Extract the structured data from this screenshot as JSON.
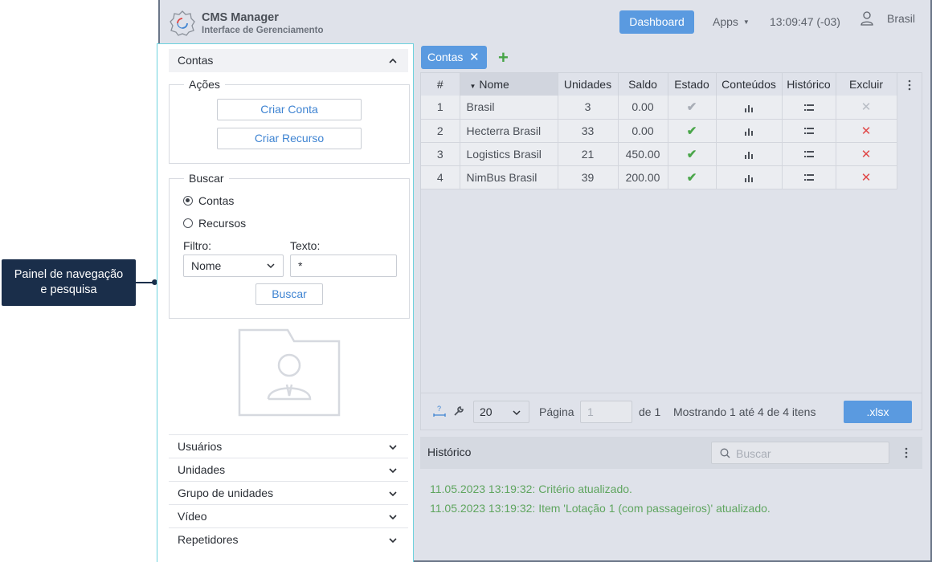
{
  "annotation": {
    "label_line1": "Painel de navegação",
    "label_line2": "e pesquisa"
  },
  "header": {
    "title": "CMS Manager",
    "subtitle": "Interface de Gerenciamento",
    "dashboard_label": "Dashboard",
    "apps_label": "Apps",
    "clock": "13:09:47 (-03)",
    "user": "Brasil"
  },
  "left": {
    "section_title": "Contas",
    "actions": {
      "legend": "Ações",
      "create_account": "Criar Conta",
      "create_resource": "Criar Recurso"
    },
    "search": {
      "legend": "Buscar",
      "radio_accounts": "Contas",
      "radio_resources": "Recursos",
      "filter_label": "Filtro:",
      "filter_value": "Nome",
      "text_label": "Texto:",
      "text_value": "*",
      "button": "Buscar"
    },
    "accordion": [
      "Usuários",
      "Unidades",
      "Grupo de unidades",
      "Vídeo",
      "Repetidores"
    ]
  },
  "tab": {
    "label": "Contas"
  },
  "table": {
    "headers": [
      "#",
      "Nome",
      "Unidades",
      "Saldo",
      "Estado",
      "Conteúdos",
      "Histórico",
      "Excluir"
    ],
    "rows": [
      {
        "n": "1",
        "name": "Brasil",
        "units": "3",
        "balance": "0.00",
        "active": false
      },
      {
        "n": "2",
        "name": "Hecterra Brasil",
        "units": "33",
        "balance": "0.00",
        "active": true
      },
      {
        "n": "3",
        "name": "Logistics Brasil",
        "units": "21",
        "balance": "450.00",
        "active": true
      },
      {
        "n": "4",
        "name": "NimBus Brasil",
        "units": "39",
        "balance": "200.00",
        "active": true
      }
    ]
  },
  "pager": {
    "page_size": "20",
    "page_label": "Página",
    "page_value": "1",
    "of_label": "de 1",
    "showing": "Mostrando 1 até 4 de 4 itens",
    "export": ".xlsx"
  },
  "history": {
    "title": "Histórico",
    "search_placeholder": "Buscar",
    "entries": [
      "11.05.2023 13:19:32: Critério atualizado.",
      "11.05.2023 13:19:32: Item 'Lotação 1 (com passageiros)' atualizado."
    ]
  },
  "colors": {
    "accent": "#5a9ae0",
    "success": "#4aa64a",
    "danger": "#e04848",
    "log": "#5fa55f",
    "callout": "#1a2e4a"
  }
}
